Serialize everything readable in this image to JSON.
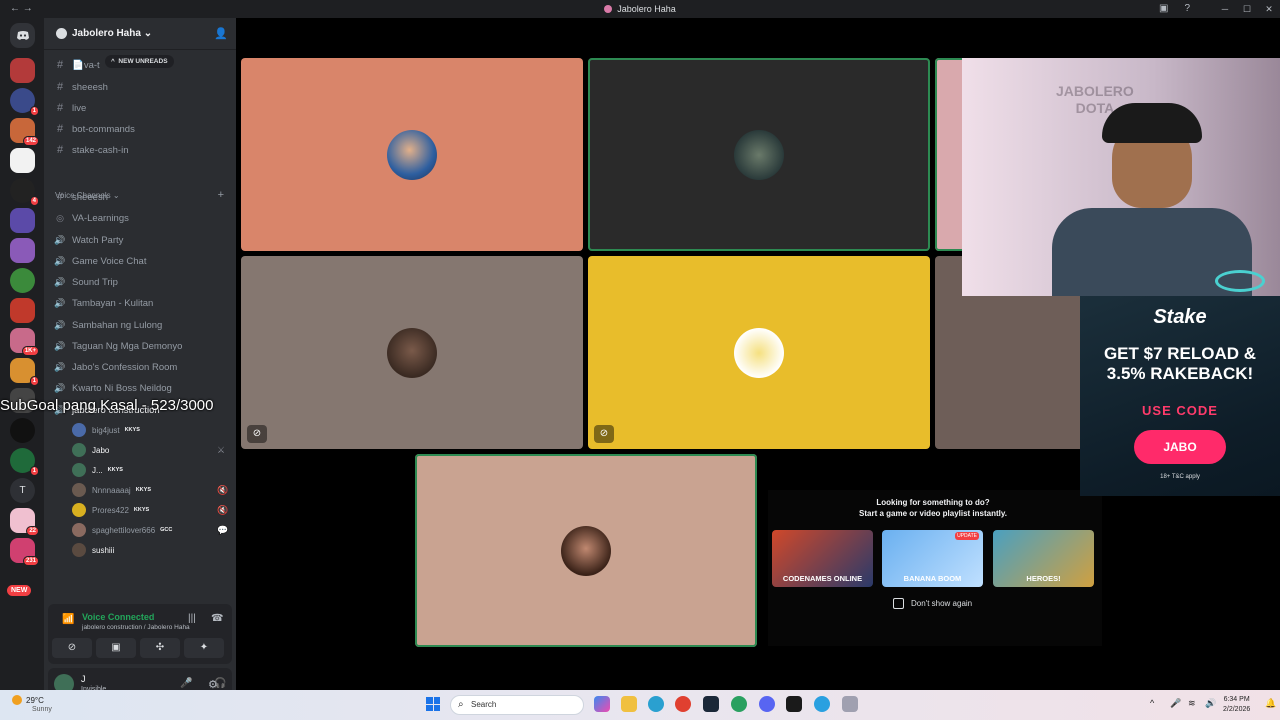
{
  "window": {
    "title": "Jabolero Haha"
  },
  "server": {
    "name": "Jabolero Haha",
    "new_unreads": "NEW UNREADS"
  },
  "text_channels": [
    {
      "name": "📄va-t"
    },
    {
      "name": "sheeesh"
    },
    {
      "name": "live"
    },
    {
      "name": "bot-commands"
    },
    {
      "name": "stake-cash-in"
    }
  ],
  "voice_category": "Voice Channels",
  "voice_channels": [
    {
      "name": "sheeesh",
      "type": "text"
    },
    {
      "name": "VA-Learnings",
      "type": "stage"
    },
    {
      "name": "Watch Party",
      "type": "voice"
    },
    {
      "name": "Game Voice Chat",
      "type": "voice"
    },
    {
      "name": "Sound Trip",
      "type": "voice"
    },
    {
      "name": "Tambayan - Kulitan",
      "type": "voice"
    },
    {
      "name": "Sambahan ng Lulong",
      "type": "voice"
    },
    {
      "name": "Taguan Ng Mga Demonyo",
      "type": "voice"
    },
    {
      "name": "Jabo's Confession Room",
      "type": "voice"
    },
    {
      "name": "Kwarto Ni Boss Neildog",
      "type": "voice"
    },
    {
      "name": "jabolero construction",
      "type": "voice"
    }
  ],
  "voice_users": [
    {
      "name": "big4just",
      "tag": "KKYS",
      "right": ""
    },
    {
      "name": "Jabo",
      "tag": "",
      "right": "⚔"
    },
    {
      "name": "J...",
      "tag": "KKYS",
      "right": ""
    },
    {
      "name": "Nnnnaaaaj",
      "tag": "KKYS",
      "right": "🔇"
    },
    {
      "name": "Prores422",
      "tag": "KKYS",
      "right": "🔇"
    },
    {
      "name": "spaghettilover666",
      "tag": "GCC",
      "right": "💬"
    },
    {
      "name": "sushiii",
      "tag": "",
      "right": ""
    }
  ],
  "guild_badges": [
    "",
    "1",
    "142",
    "",
    "4",
    "",
    "",
    "",
    "",
    "",
    "1K+",
    "1",
    "",
    "",
    "1",
    "",
    "22",
    "231"
  ],
  "new_label": "NEW",
  "voice_status": {
    "title": "Voice Connected",
    "subtitle": "jabolero construction / Jabolero Haha"
  },
  "user": {
    "name": "J",
    "status": "Invisible"
  },
  "activity": {
    "line1": "Looking for something to do?",
    "line2": "Start a game or video playlist instantly.",
    "games": [
      {
        "title": "CODENAMES ONLINE",
        "badge": ""
      },
      {
        "title": "BANANA BOOM",
        "badge": "UPDATE"
      },
      {
        "title": "HEROES!",
        "badge": ""
      }
    ],
    "dont_show": "Don't show again"
  },
  "overlay": {
    "subgoal": "SubGoal pang Kasal - 523/3000",
    "cam_watermark_1": "JABOLERO",
    "cam_watermark_2": "DOTA"
  },
  "ad": {
    "logo": "Stake",
    "headline_1": "GET $7 RELOAD &",
    "headline_2": "3.5% RAKEBACK!",
    "use_code": "USE CODE",
    "code": "JABO",
    "terms": "18+ T&C apply"
  },
  "taskbar": {
    "temp": "29°C",
    "weather": "Sunny",
    "search_placeholder": "Search",
    "time": "6:34 PM",
    "date": "2/2/2026"
  },
  "colors": {
    "discord_bg": "#2b2d31",
    "voice_green": "#23a55a",
    "tile_orange": "#d9856a",
    "tile_dark": "#2a2a2a",
    "tile_brown": "#857770",
    "tile_yellow": "#e8bd2b",
    "tile_pink": "#c9a391"
  }
}
